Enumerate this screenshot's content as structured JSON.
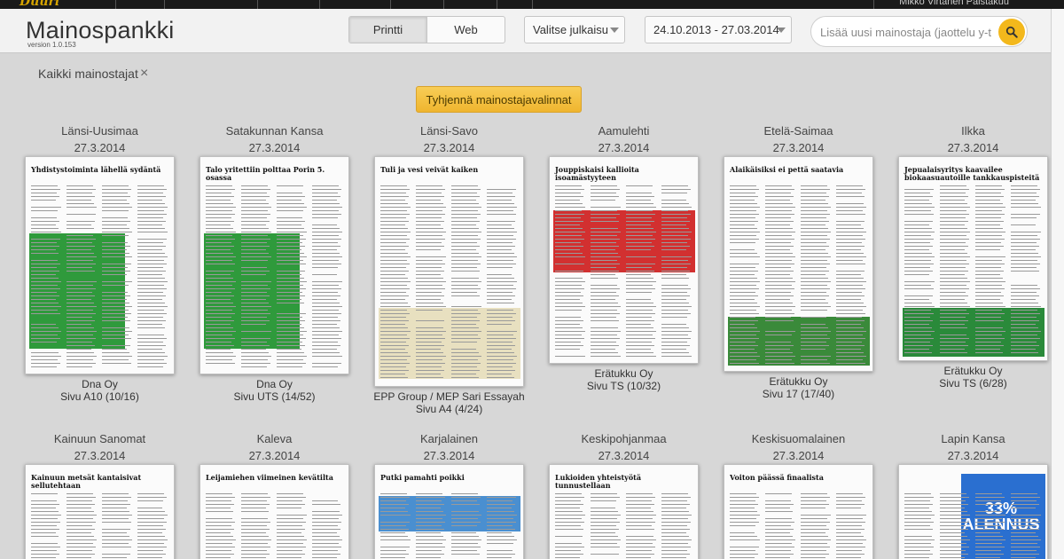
{
  "app": {
    "logo_text": "Duuri",
    "title": "Mainospankki",
    "version": "version 1.0.153",
    "user_text": "Mikko Virtanen Palstakuu"
  },
  "toolbar": {
    "print_label": "Printti",
    "web_label": "Web",
    "publication_select": "Valitse julkaisu",
    "date_range": "24.10.2013 - 27.03.2014",
    "search_placeholder": "Lisää uusi mainostaja (jaottelu y-t",
    "search_icon": "search-icon"
  },
  "filters": {
    "chip_label": "Kaikki mainostajat",
    "remove_icon": "close-icon",
    "clear_label": "Tyhjennä mainostajavalinnat"
  },
  "colors": {
    "accent": "#f3b81c",
    "button_bg": "#efb52f",
    "background": "#d7d7d7"
  },
  "ads": [
    {
      "publication": "Länsi-Uusimaa",
      "date": "27.3.2014",
      "advertiser": "Dna Oy",
      "page": "Sivu A10 (10/16)"
    },
    {
      "publication": "Satakunnan Kansa",
      "date": "27.3.2014",
      "advertiser": "Dna Oy",
      "page": "Sivu UTS (14/52)"
    },
    {
      "publication": "Länsi-Savo",
      "date": "27.3.2014",
      "advertiser": "EPP Group / MEP Sari Essayah",
      "page": "Sivu A4 (4/24)"
    },
    {
      "publication": "Aamulehti",
      "date": "27.3.2014",
      "advertiser": "Erätukku Oy",
      "page": "Sivu TS (10/32)"
    },
    {
      "publication": "Etelä-Saimaa",
      "date": "27.3.2014",
      "advertiser": "Erätukku Oy",
      "page": "Sivu 17 (17/40)"
    },
    {
      "publication": "Ilkka",
      "date": "27.3.2014",
      "advertiser": "Erätukku Oy",
      "page": "Sivu TS (6/28)"
    },
    {
      "publication": "Kainuun Sanomat",
      "date": "27.3.2014",
      "advertiser": "",
      "page": ""
    },
    {
      "publication": "Kaleva",
      "date": "27.3.2014",
      "advertiser": "",
      "page": ""
    },
    {
      "publication": "Karjalainen",
      "date": "27.3.2014",
      "advertiser": "",
      "page": ""
    },
    {
      "publication": "Keskipohjanmaa",
      "date": "27.3.2014",
      "advertiser": "",
      "page": ""
    },
    {
      "publication": "Keskisuomalainen",
      "date": "27.3.2014",
      "advertiser": "",
      "page": ""
    },
    {
      "publication": "Lapin Kansa",
      "date": "27.3.2014",
      "advertiser": "",
      "page": ""
    }
  ],
  "thumb_headlines": [
    "Yhdistystoiminta lähellä sydäntä",
    "Talo yritettiin polttaa Porin 5. osassa",
    "Tuli ja vesi veivät kaiken",
    "Jouppiskaisi kallioita isoamästyyteen",
    "Alaikäisiksi ei pettä saatavia",
    "Jepualaisyritys kaavailee biokaasuautoille tankkauspisteitä",
    "Kainuun metsät kantaisivat sellutehtaan",
    "Leijamiehen viimeinen kevätilta",
    "Putki pamahti poikki",
    "Lukioiden yhteistyötä tunnustellaan",
    "Voiton päässä finaalista",
    "33% ALENNUS"
  ]
}
